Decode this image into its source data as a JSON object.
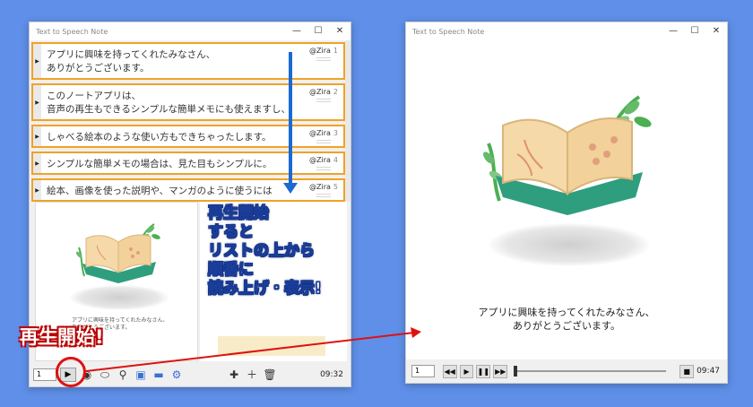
{
  "left_window": {
    "title": "Text to Speech Note",
    "window_controls": [
      "—",
      "☐",
      "✕"
    ],
    "rows": [
      {
        "text": "アプリに興味を持ってくれたみなさん、\nありがとうございます。",
        "voice": "@Zira",
        "num": "1"
      },
      {
        "text": "このノートアプリは、\n音声の再生もできるシンプルな簡単メモにも使えますし、",
        "voice": "@Zira",
        "num": "2"
      },
      {
        "text": "しゃべる絵本のような使い方もできちゃったします。",
        "voice": "@Zira",
        "num": "3"
      },
      {
        "text": "シンプルな簡単メモの場合は、見た目もシンプルに。",
        "voice": "@Zira",
        "num": "4"
      },
      {
        "text": "絵本、画像を使った説明や、マンガのように使うには",
        "voice": "@Zira",
        "num": "5"
      }
    ],
    "preview_text": "アプリに興味を持ってくれたみなさん、\nありがとうございます。",
    "toolbar": {
      "page_select": "1",
      "time": "09:32"
    }
  },
  "right_window": {
    "title": "Text to Speech Note",
    "window_controls": [
      "—",
      "☐",
      "✕"
    ],
    "caption": "アプリに興味を持ってくれたみなさん、\nありがとうございます。",
    "controls": {
      "page_select": "1",
      "time": "09:47"
    }
  },
  "annotations": {
    "callout": "再生開始\nすると\nリストの上から\n順番に\n読み上げ・表示!",
    "start_label": "再生開始!"
  },
  "colors": {
    "background": "#5f8fe8",
    "highlight_border": "#f0a226",
    "arrow_blue": "#1a6ad4",
    "arrow_red": "#e01010"
  }
}
